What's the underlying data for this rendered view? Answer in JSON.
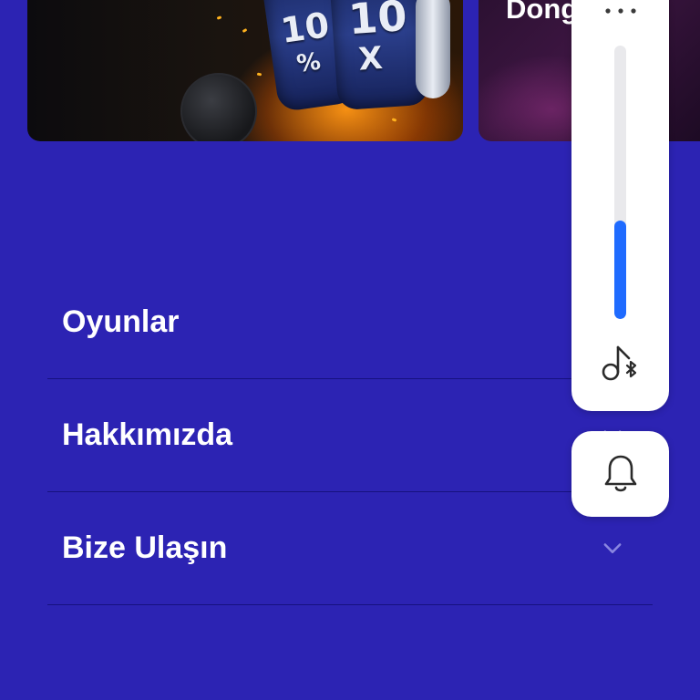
{
  "promo": {
    "card1": {
      "reel_text_a": "10",
      "reel_text_b": "10",
      "reel_text_c": "X",
      "reel_text_d": "%"
    },
    "card2": {
      "title": "Dong"
    }
  },
  "menu": {
    "items": [
      {
        "label": "Oyunlar",
        "icon": "chevron-down-icon"
      },
      {
        "label": "Hakkımızda",
        "icon": "chevron-down-icon"
      },
      {
        "label": "Bize Ulaşın",
        "icon": "chevron-down-icon"
      }
    ]
  },
  "volume_panel": {
    "level": 0.36,
    "more_icon": "more-dots-icon",
    "output_icon": "music-bluetooth-icon"
  },
  "ringer": {
    "icon": "bell-icon"
  },
  "colors": {
    "background": "#2c23b3",
    "divider": "#1a1580",
    "slider_fill": "#1f6bff",
    "slider_track": "#e9e9ec",
    "panel": "#ffffff"
  }
}
